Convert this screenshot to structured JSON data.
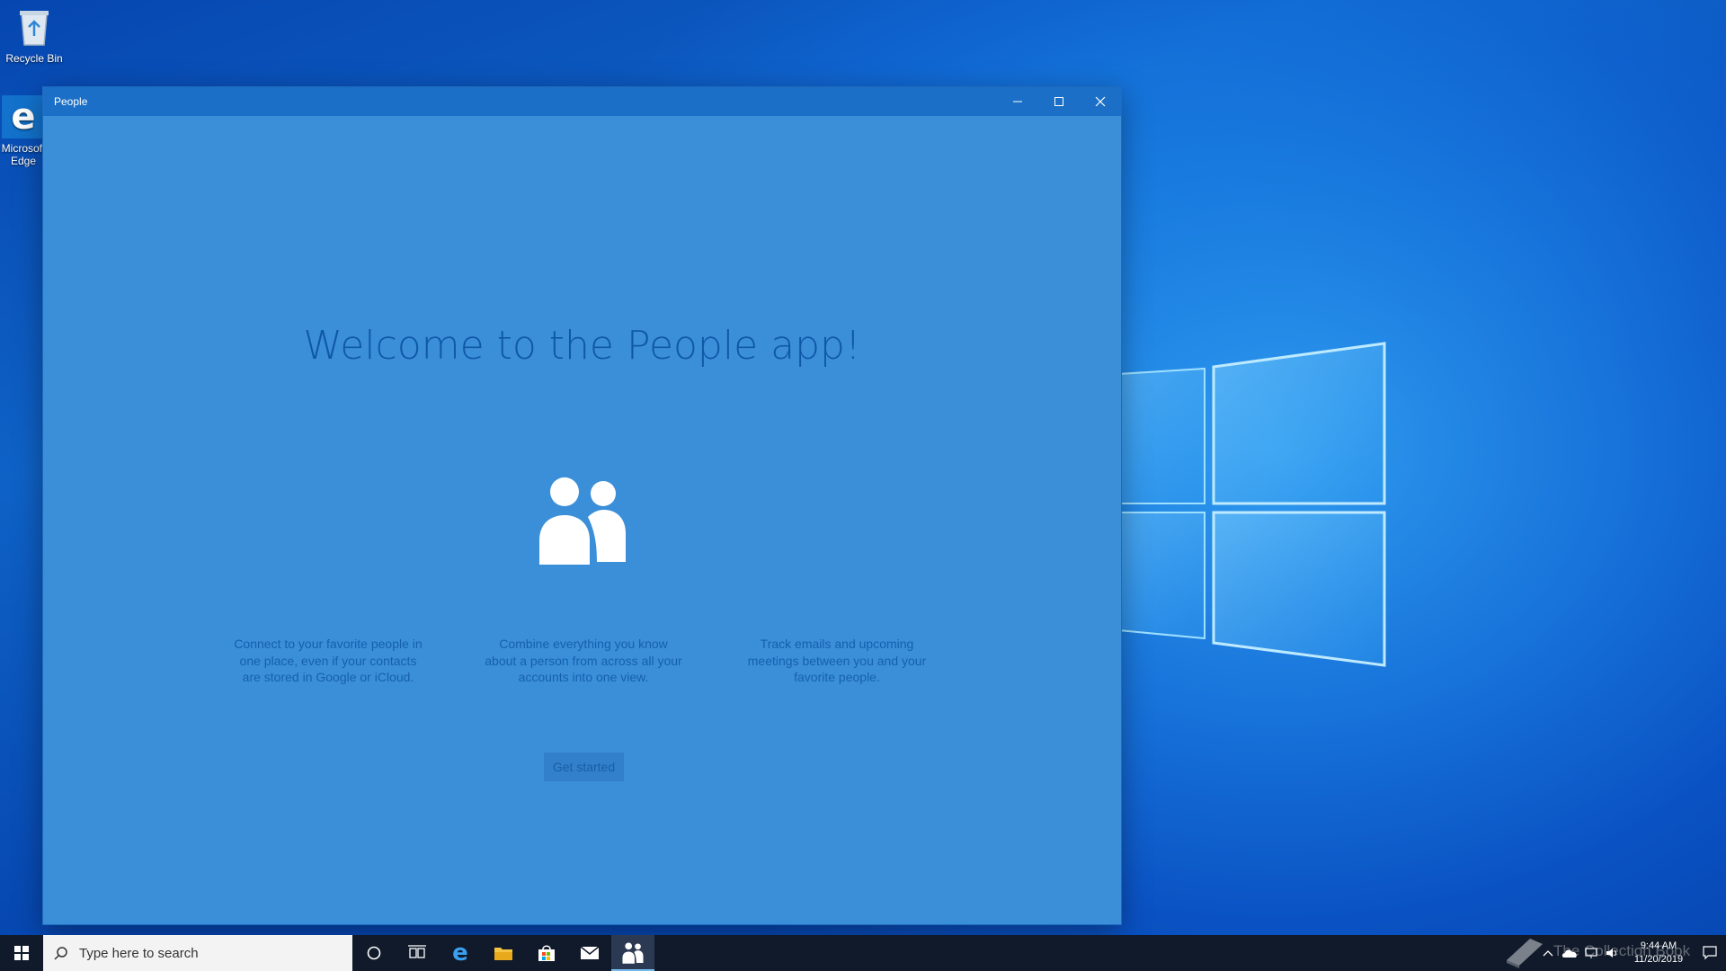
{
  "desktop": {
    "icons": [
      {
        "label": "Recycle Bin"
      },
      {
        "label": "Microsoft Edge"
      }
    ]
  },
  "window": {
    "title": "People",
    "controls": {
      "minimize": "minimize-icon",
      "maximize": "maximize-icon",
      "close": "close-icon"
    }
  },
  "app": {
    "welcome": "Welcome to the People app!",
    "features": [
      "Connect to your favorite people in one place, even if your contacts are stored in Google or iCloud.",
      "Combine everything you know about a person from across all your accounts into one view.",
      "Track emails and upcoming meetings between you and your favorite people."
    ],
    "get_started": "Get started"
  },
  "taskbar": {
    "search_placeholder": "Type here to search",
    "apps": [
      "cortana-icon",
      "task-view-icon",
      "edge-icon",
      "file-explorer-icon",
      "store-icon",
      "mail-icon",
      "people-icon"
    ],
    "active_app": "people-icon",
    "time": "9:44 AM",
    "date": "11/20/2019"
  },
  "watermark": "The Collection Book",
  "colors": {
    "window_bg": "#3b8fd9",
    "titlebar": "#1b6fc6",
    "welcome_text": "#0f58a8",
    "taskbar": "#101a2a"
  }
}
